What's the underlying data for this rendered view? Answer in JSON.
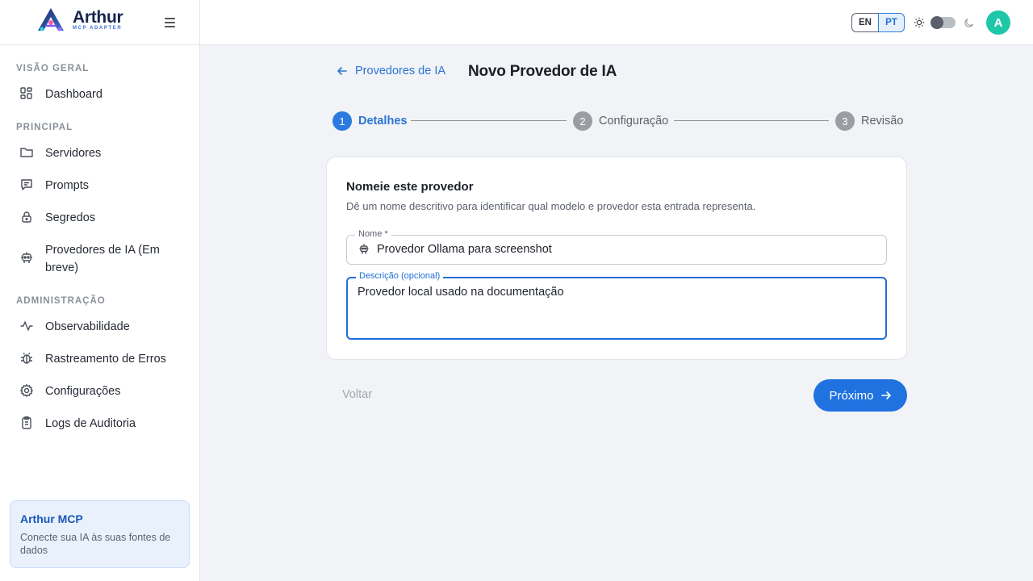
{
  "brand": {
    "name": "Arthur",
    "subtitle": "MCP ADAPTER"
  },
  "sidebar": {
    "sections": [
      {
        "label": "VISÃO GERAL"
      },
      {
        "label": "PRINCIPAL"
      },
      {
        "label": "ADMINISTRAÇÃO"
      }
    ],
    "items": [
      {
        "label": "Dashboard",
        "icon": "dashboard-icon"
      },
      {
        "label": "Servidores",
        "icon": "folder-icon"
      },
      {
        "label": "Prompts",
        "icon": "message-icon"
      },
      {
        "label": "Segredos",
        "icon": "lock-icon"
      },
      {
        "label": "Provedores de IA (Em breve)",
        "icon": "robot-icon"
      },
      {
        "label": "Observabilidade",
        "icon": "activity-icon"
      },
      {
        "label": "Rastreamento de Erros",
        "icon": "bug-icon"
      },
      {
        "label": "Configurações",
        "icon": "gear-icon"
      },
      {
        "label": "Logs de Auditoria",
        "icon": "clipboard-icon"
      }
    ],
    "promo": {
      "title": "Arthur MCP",
      "description": "Conecte sua IA às suas fontes de dados"
    }
  },
  "topbar": {
    "languages": [
      "EN",
      "PT"
    ],
    "selected_language": "PT",
    "theme": "light",
    "avatar_initial": "A"
  },
  "page": {
    "back_link": "Provedores de IA",
    "title": "Novo Provedor de IA",
    "steps": [
      {
        "number": "1",
        "label": "Detalhes",
        "active": true
      },
      {
        "number": "2",
        "label": "Configuração",
        "active": false
      },
      {
        "number": "3",
        "label": "Revisão",
        "active": false
      }
    ],
    "card": {
      "title": "Nomeie este provedor",
      "description": "Dê um nome descritivo para identificar qual modelo e provedor esta entrada representa.",
      "name_field": {
        "label": "Nome *",
        "value": "Provedor Ollama para screenshot"
      },
      "description_field": {
        "label": "Descrição (opcional)",
        "value": "Provedor local usado na documentação"
      }
    },
    "buttons": {
      "back": "Voltar",
      "next": "Próximo"
    }
  },
  "colors": {
    "accent": "#1f72e0",
    "avatar": "#1fc7a8",
    "promo_bg": "#e9f1fd"
  }
}
